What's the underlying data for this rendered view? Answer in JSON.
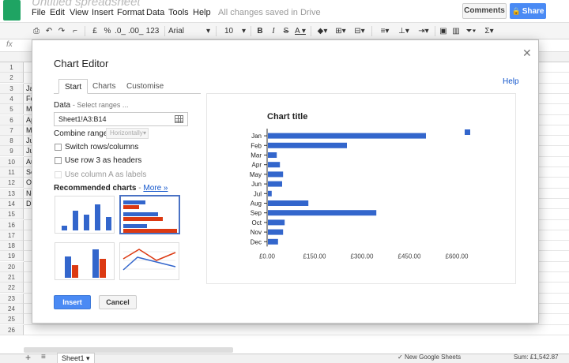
{
  "app": {
    "doc_title": "Untitled spreadsheet",
    "save_status": "All changes saved in Drive",
    "menu": [
      "File",
      "Edit",
      "View",
      "Insert",
      "Format",
      "Data",
      "Tools",
      "Help"
    ],
    "comments_label": "Comments",
    "share_label": "Share",
    "fx_label": "fx"
  },
  "toolbar": {
    "currency": "£",
    "percent": "%",
    "dec_less": ".0_",
    "dec_more": ".00_",
    "number_format": "123",
    "font": "Arial",
    "font_size": "10",
    "bold": "B",
    "italic": "I",
    "strike": "S",
    "text_color": "A"
  },
  "grid": {
    "rows": [
      "1",
      "2",
      "3",
      "4",
      "5",
      "6",
      "7",
      "8",
      "9",
      "10",
      "11",
      "12",
      "13",
      "14",
      "15",
      "16",
      "17",
      "18",
      "19",
      "20",
      "21",
      "22",
      "23",
      "24",
      "25",
      "26"
    ],
    "cells": [
      "Ja",
      "Fe",
      "M",
      "Ap",
      "M",
      "Ju",
      "Ju",
      "Au",
      "Se",
      "Oc",
      "No",
      "De"
    ]
  },
  "sheets": {
    "tab_label": "Sheet1",
    "new_sheets": "New Google Sheets",
    "sum": "Sum: £1,542.87"
  },
  "editor": {
    "title": "Chart Editor",
    "help": "Help",
    "tabs": [
      "Start",
      "Charts",
      "Customise"
    ],
    "data_label": "Data",
    "data_hint": "- Select ranges ...",
    "range_value": "Sheet1!A3:B14",
    "combine_label": "Combine ranges:",
    "combine_value": "Horizontally",
    "switch_rows": "Switch rows/columns",
    "use_row_headers": "Use row 3 as headers",
    "use_col_labels": "Use column A as labels",
    "recommended": "Recommended charts",
    "more_link": "More »",
    "insert": "Insert",
    "cancel": "Cancel"
  },
  "colors": {
    "series": "#3366cc",
    "accent_red": "#dc3912",
    "primary_button": "#4a8af4"
  },
  "chart_data": {
    "type": "bar",
    "orientation": "horizontal",
    "title": "Chart title",
    "categories": [
      "Jan",
      "Feb",
      "Mar",
      "Apr",
      "May",
      "Jun",
      "Jul",
      "Aug",
      "Sep",
      "Oct",
      "Nov",
      "Dec"
    ],
    "values": [
      500,
      250,
      28,
      38,
      48,
      45,
      12,
      128,
      343,
      53,
      48,
      32
    ],
    "xlim": [
      0,
      600
    ],
    "xticks": [
      "£0.00",
      "£150.00",
      "£300.00",
      "£450.00",
      "£600.00"
    ],
    "xtick_values": [
      0,
      150,
      300,
      450,
      600
    ],
    "grid": false,
    "legend": "right"
  }
}
